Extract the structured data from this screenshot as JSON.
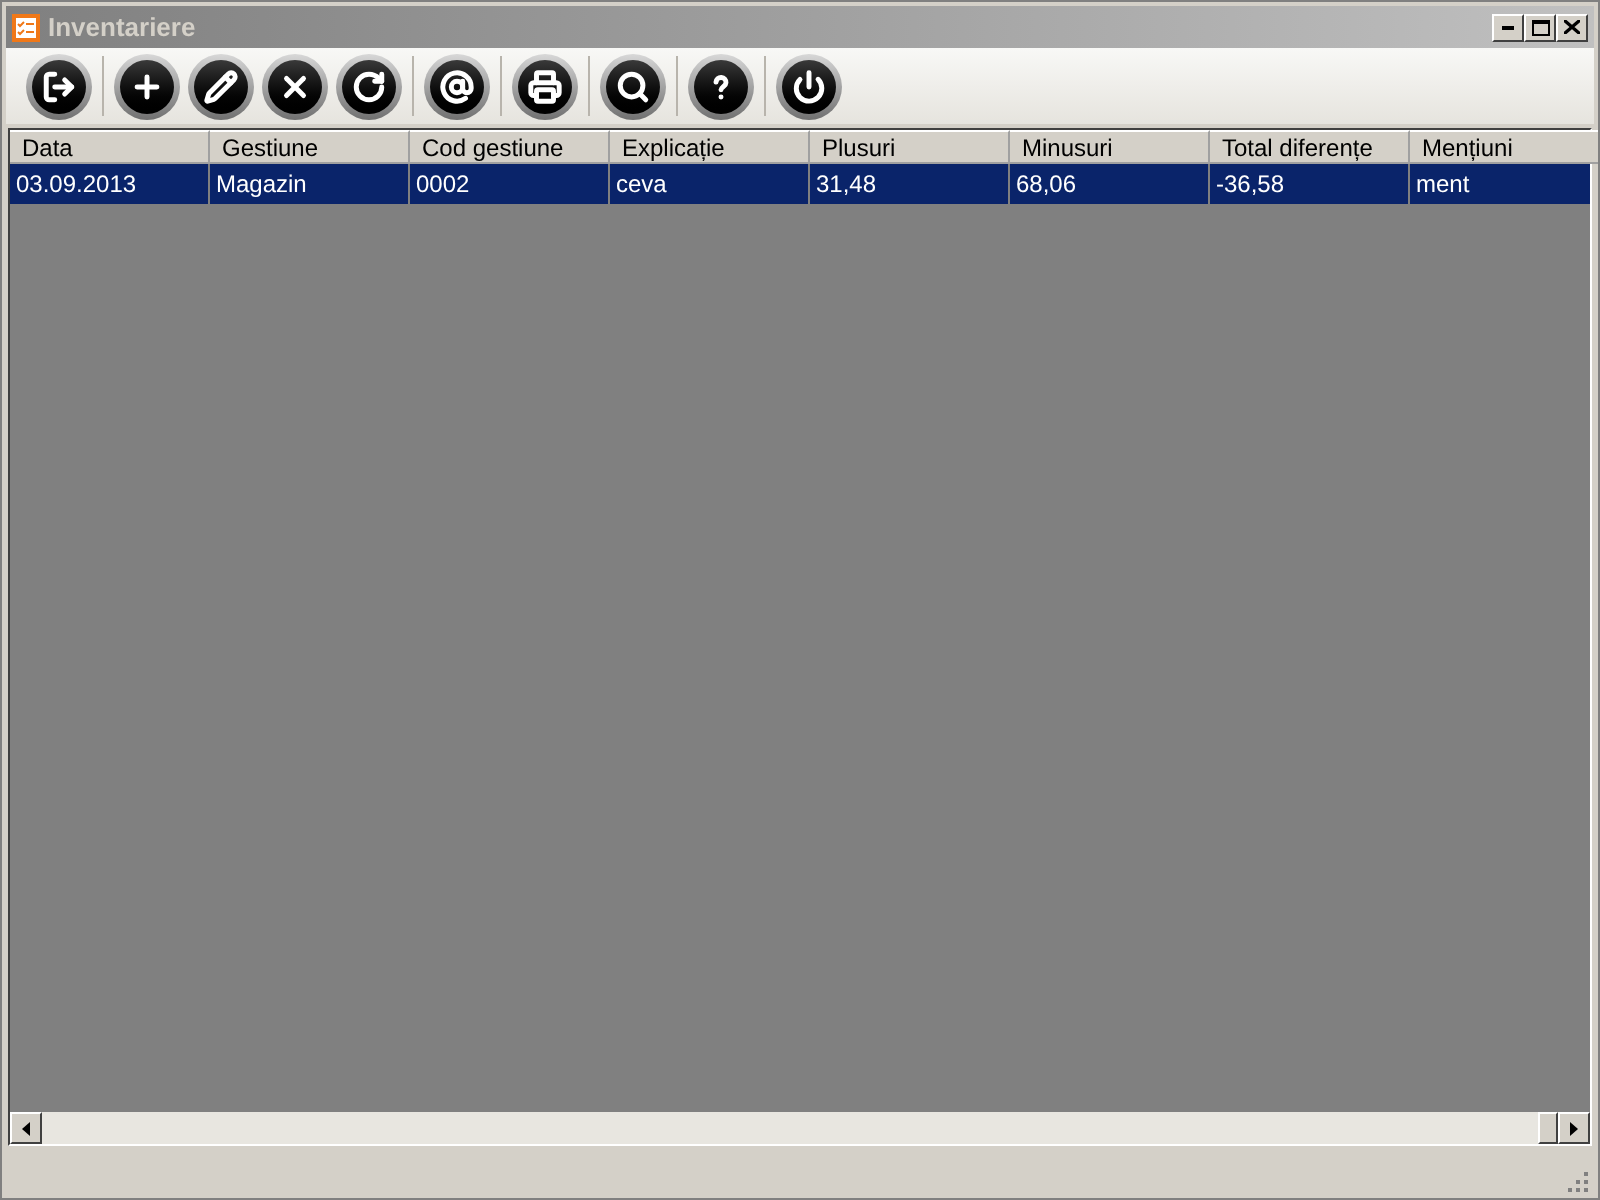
{
  "window": {
    "title": "Inventariere"
  },
  "toolbar": [
    {
      "kind": "exit"
    },
    {
      "kind": "add"
    },
    {
      "kind": "edit"
    },
    {
      "kind": "delete"
    },
    {
      "kind": "refresh"
    },
    {
      "kind": "email"
    },
    {
      "kind": "print"
    },
    {
      "kind": "search"
    },
    {
      "kind": "help"
    },
    {
      "kind": "power"
    }
  ],
  "table": {
    "columns": [
      "Data",
      "Gestiune",
      "Cod gestiune",
      "Explicație",
      "Plusuri",
      "Minusuri",
      "Total diferențe",
      "Mențiuni"
    ],
    "rows": [
      {
        "selected": true,
        "cells": [
          "03.09.2013",
          "Magazin",
          "0002",
          "ceva",
          "31,48",
          "68,06",
          "-36,58",
          "ment"
        ]
      }
    ]
  }
}
